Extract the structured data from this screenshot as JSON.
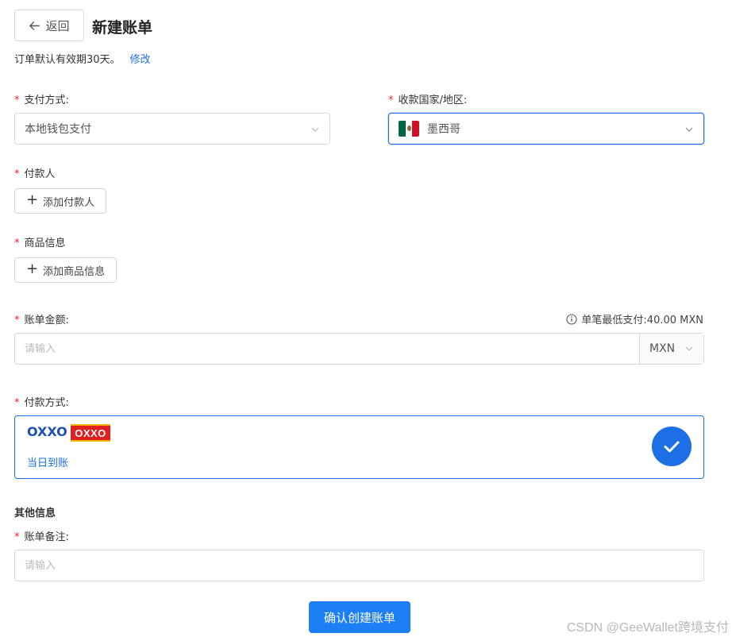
{
  "header": {
    "back_label": "返回",
    "title": "新建账单"
  },
  "validity": {
    "text": "订单默认有效期30天。",
    "edit_link": "修改"
  },
  "payment_method": {
    "label": "支付方式:",
    "value": "本地钱包支付"
  },
  "country": {
    "label": "收款国家/地区:",
    "value": "墨西哥",
    "flag_colors": [
      "#006847",
      "#ffffff",
      "#ce1126"
    ]
  },
  "payer": {
    "label": "付款人",
    "add_label": "添加付款人"
  },
  "goods": {
    "label": "商品信息",
    "add_label": "添加商品信息"
  },
  "amount": {
    "label": "账单金额:",
    "placeholder": "请输入",
    "hint": "单笔最低支付:40.00 MXN",
    "currency": "MXN"
  },
  "pay_option": {
    "label": "付款方式:",
    "name": "OXXO",
    "logo_text": "OXXO",
    "arrival": "当日到账",
    "selected": true
  },
  "other": {
    "section_title": "其他信息",
    "remark_label": "账单备注:",
    "remark_placeholder": "请输入"
  },
  "submit_label": "确认创建账单",
  "watermark": "CSDN @GeeWallet跨境支付",
  "colors": {
    "primary": "#1d6fe5",
    "button": "#1d7ff5",
    "required": "#f5222d"
  }
}
